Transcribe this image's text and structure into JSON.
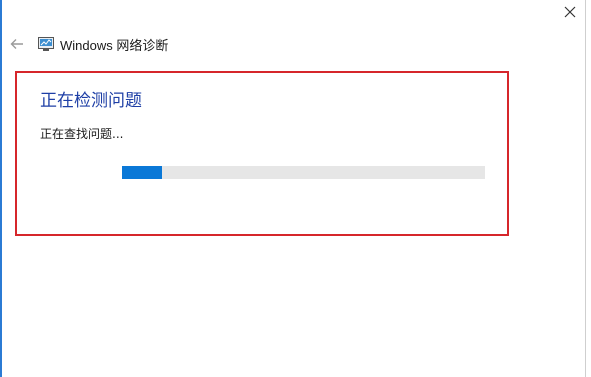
{
  "window": {
    "title": "Windows 网络诊断",
    "icon": "network-diagnostics-icon",
    "back_icon": "back-arrow-icon",
    "close_icon": "close-icon",
    "accent_color": "#0a78d7",
    "highlight_color": "#d6262b"
  },
  "main": {
    "heading": "正在检测问题",
    "status": "正在查找问题...",
    "progress": 0.11
  }
}
